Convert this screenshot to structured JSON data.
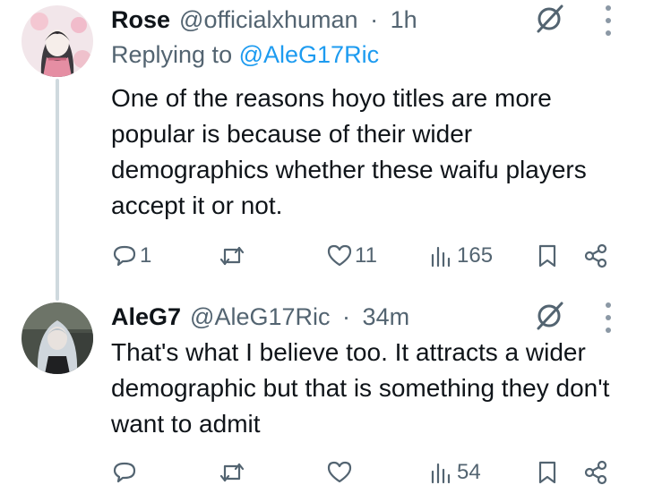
{
  "tweets": [
    {
      "author": "Rose",
      "handle": "@officialxhuman",
      "time": "1h",
      "replying_label": "Replying to",
      "replying_to": "@AleG17Ric",
      "text": "One of the reasons hoyo titles are more popular is because of their wider demographics whether these waifu players accept it or not.",
      "replies": "1",
      "reposts": "",
      "likes": "11",
      "views": "165"
    },
    {
      "author": "AleG7",
      "handle": "@AleG17Ric",
      "time": "34m",
      "text": "That's what I believe too. It attracts a wider demographic but that is something they don't want to admit",
      "replies": "",
      "reposts": "",
      "likes": "",
      "views": "54"
    }
  ],
  "separator": "·",
  "icons": {
    "reply": "reply-icon",
    "repost": "repost-icon",
    "like": "heart-icon",
    "views": "views-icon",
    "bookmark": "bookmark-icon",
    "share": "share-icon",
    "grok": "grok-icon",
    "more": "more-icon"
  },
  "colors": {
    "text": "#0f1419",
    "secondary": "#536471",
    "link": "#1d9bf0",
    "thread_line": "#cfd9de"
  }
}
